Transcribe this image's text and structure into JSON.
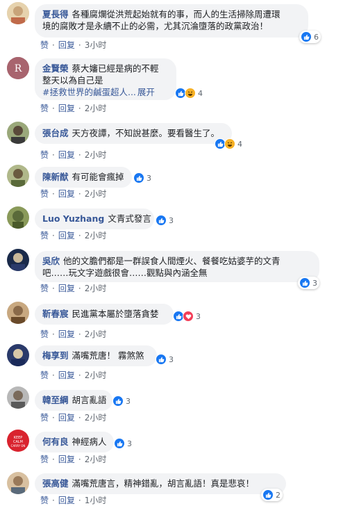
{
  "comments": [
    {
      "name": "夏長得",
      "lines": [
        "各種腐爛從洪荒起始就有的事，而人的生活掃除周遭環",
        "境的腐敗才是永續不止的必需，尤其沉淪墮落的政黨政治！"
      ],
      "reactions": [
        "like"
      ],
      "count": "6",
      "like_label": "赞",
      "reply_label": "回复",
      "time": "3小时",
      "avatar_color": "#c8a47a"
    },
    {
      "name": "金賢榮",
      "lines": [
        "蔡大嬸已經是病的不輕",
        "整天以為自己是",
        "#拯救世界的鹹蛋超人..."
      ],
      "expand": "展开",
      "reactions": [
        "like",
        "haha"
      ],
      "count": "4",
      "like_label": "赞",
      "reply_label": "回复",
      "time": "2小时",
      "avatar_color": "#a8646e",
      "avatar_letter": "R"
    },
    {
      "name": "張台成",
      "lines": [
        "天方夜譚，不知說甚麼。要看醫生了。"
      ],
      "reactions": [
        "like",
        "haha"
      ],
      "count": "4",
      "like_label": "赞",
      "reply_label": "回复",
      "time": "2小时",
      "avatar_color": "#6b7a4a"
    },
    {
      "name": "陳新猷",
      "lines": [
        "有可能會瘋掉"
      ],
      "reactions": [
        "like"
      ],
      "count": "3",
      "like_label": "赞",
      "reply_label": "回复",
      "time": "2小时",
      "avatar_color": "#8a9a6a"
    },
    {
      "name": "Luo Yuzhang",
      "lines": [
        "文青式發言"
      ],
      "reactions": [
        "like"
      ],
      "count": "3",
      "like_label": "赞",
      "reply_label": "回复",
      "time": "2小时",
      "avatar_color": "#7d8f5c"
    },
    {
      "name": "吳欣",
      "lines": [
        "他的文膽們都是一群誤食人間煙火、餐餐吃姑婆芋的文青",
        "吧……玩文字遊戲很會……觀點與內涵全無"
      ],
      "reactions": [
        "like"
      ],
      "count": "3",
      "like_label": "赞",
      "reply_label": "回复",
      "time": "2小时",
      "avatar_color": "#2c3e5a"
    },
    {
      "name": "靳春宸",
      "lines": [
        "民進黨本屬於墮落貪婪"
      ],
      "reactions": [
        "like",
        "love"
      ],
      "count": "3",
      "like_label": "赞",
      "reply_label": "回复",
      "time": "2小时",
      "avatar_color": "#8a6a4a"
    },
    {
      "name": "梅享到",
      "lines": [
        "滿嘴荒唐！ 霧煞煞"
      ],
      "reactions": [
        "like"
      ],
      "count": "3",
      "like_label": "赞",
      "reply_label": "回复",
      "time": "2小时",
      "avatar_color": "#3a4a7a"
    },
    {
      "name": "韓至綱",
      "lines": [
        "胡言亂語"
      ],
      "reactions": [
        "like"
      ],
      "count": "3",
      "like_label": "赞",
      "reply_label": "回复",
      "time": "2小时",
      "avatar_color": "#9a9a9a"
    },
    {
      "name": "何有良",
      "lines": [
        "神經病人"
      ],
      "reactions": [
        "like"
      ],
      "count": "3",
      "like_label": "赞",
      "reply_label": "回复",
      "time": "2小时",
      "avatar_color": "#d9232e",
      "avatar_text": "KEEP CALM"
    },
    {
      "name": "張高健",
      "lines": [
        "滿嘴荒唐言，精神錯亂，胡言亂語！真是悲哀！"
      ],
      "reactions": [
        "like"
      ],
      "count": "2",
      "like_label": "赞",
      "reply_label": "回复",
      "time": "1小时",
      "avatar_color": "#b08a6a"
    }
  ]
}
